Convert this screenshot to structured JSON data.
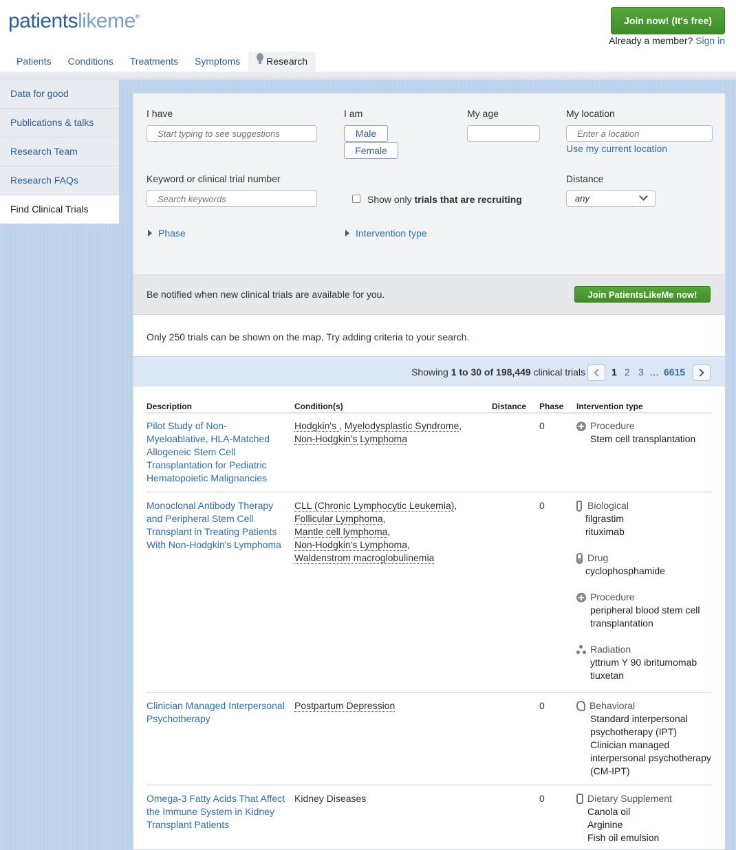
{
  "header": {
    "logo_main": "patients",
    "logo_light": "likeme",
    "logo_reg": "®",
    "join_button": "Join now! (It's free)",
    "member_prompt": "Already a member?",
    "sign_in": "Sign in"
  },
  "nav": {
    "items": [
      "Patients",
      "Conditions",
      "Treatments",
      "Symptoms",
      "Research"
    ],
    "active": "Research"
  },
  "sidebar": {
    "items": [
      "Data for good",
      "Publications & talks",
      "Research Team",
      "Research FAQs",
      "Find Clinical Trials"
    ],
    "active": "Find Clinical Trials"
  },
  "filters": {
    "i_have_label": "I have",
    "i_have_placeholder": "Start typing to see suggestions",
    "i_am_label": "I am",
    "gender_options": [
      "Male",
      "Female"
    ],
    "age_label": "My age",
    "age_value": "",
    "location_label": "My location",
    "location_placeholder": "Enter a location",
    "use_location": "Use my current location",
    "keyword_label": "Keyword or clinical trial number",
    "keyword_placeholder": "Search keywords",
    "recruiting_prefix": "Show only ",
    "recruiting_bold": "trials that are recruiting",
    "recruiting_checked": false,
    "distance_label": "Distance",
    "distance_value": "any",
    "phase_toggle": "Phase",
    "intervention_toggle": "Intervention type"
  },
  "notify": {
    "text": "Be notified when new clinical trials are available for you.",
    "button": "Join PatientsLikeMe now!"
  },
  "map_note": "Only 250 trials can be shown on the map. Try adding criteria to your search.",
  "pagination": {
    "showing_prefix": "Showing ",
    "range": "1 to 30 of 198,449",
    "suffix": " clinical trials",
    "pages": [
      "1",
      "2",
      "3"
    ],
    "ellipsis": "…",
    "last_page": "6615",
    "current": "1"
  },
  "table": {
    "headers": [
      "Description",
      "Condition(s)",
      "Distance",
      "Phase",
      "Intervention type"
    ],
    "rows": [
      {
        "description": "Pilot Study of Non-Myeloablative, HLA-Matched Allogeneic Stem Cell Transplantation for Pediatric Hematopoietic Malignancies",
        "conditions": [
          "Hodgkin's ",
          "Myelodysplastic Syndrome",
          "Non-Hodgkin's Lymphoma"
        ],
        "distance": "",
        "phase": "0",
        "interventions": [
          {
            "type": "Procedure",
            "icon": "plus-circle-icon",
            "names": [
              "Stem cell transplantation"
            ]
          }
        ]
      },
      {
        "description": "Monoclonal Antibody Therapy and Peripheral Stem Cell Transplant in Treating Patients With Non-Hodgkin's Lymphoma",
        "conditions": [
          "CLL (Chronic Lymphocytic Leukemia)",
          "Follicular Lymphoma",
          "Mantle cell lymphoma",
          "Non-Hodgkin's Lymphoma",
          "Waldenstrom macroglobulinemia"
        ],
        "distance": "",
        "phase": "0",
        "interventions": [
          {
            "type": "Biological",
            "icon": "vial-icon",
            "names": [
              "filgrastim",
              "rituximab"
            ]
          },
          {
            "type": "Drug",
            "icon": "pill-icon",
            "names": [
              "cyclophosphamide"
            ]
          },
          {
            "type": "Procedure",
            "icon": "plus-circle-icon",
            "names": [
              "peripheral blood stem cell transplantation"
            ]
          },
          {
            "type": "Radiation",
            "icon": "radiation-icon",
            "names": [
              "yttrium Y 90 ibritumomab tiuxetan"
            ]
          }
        ]
      },
      {
        "description": "Clinician Managed Interpersonal Psychotherapy",
        "conditions": [
          "Postpartum Depression"
        ],
        "distance": "",
        "phase": "0",
        "interventions": [
          {
            "type": "Behavioral",
            "icon": "head-icon",
            "names": [
              "Standard interpersonal psychotherapy (IPT)",
              "Clinician managed interpersonal psychotherapy (CM-IPT)"
            ]
          }
        ]
      },
      {
        "description": "Omega-3 Fatty Acids That Affect the Immune System in Kidney Transplant Patients",
        "conditions_plain": "Kidney Diseases",
        "distance": "",
        "phase": "0",
        "interventions": [
          {
            "type": "Dietary Supplement",
            "icon": "bottle-icon",
            "names": [
              "Canola oil",
              "Arginine",
              "Fish oil emulsion"
            ]
          }
        ]
      }
    ]
  },
  "colors": {
    "link": "#2f6fb3",
    "brand": "#2f5f9c",
    "join_green": "#4a9a30",
    "page_bg": "#bdd3ec"
  }
}
